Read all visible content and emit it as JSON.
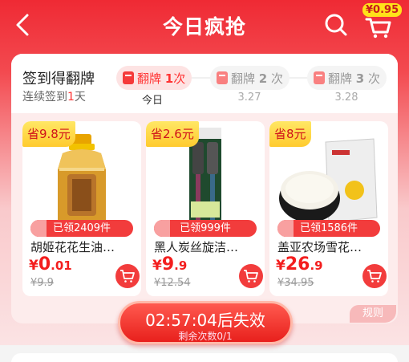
{
  "header": {
    "title": "今日疯抢",
    "cart_badge": "¥0.95"
  },
  "signin": {
    "title": "签到得翻牌",
    "sub_prefix": "连续签到",
    "sub_days": "1",
    "sub_suffix": "天",
    "steps": [
      {
        "label": "翻牌",
        "count": "1",
        "unit": "次",
        "date": "今日"
      },
      {
        "label": "翻牌",
        "count": "2",
        "unit": "次",
        "date": "3.27"
      },
      {
        "label": "翻牌",
        "count": "3",
        "unit": "次",
        "date": "3.28"
      }
    ]
  },
  "products": [
    {
      "save": "省9.8元",
      "claimed": "已领2409件",
      "name": "胡姬花花生油…",
      "yen": "¥",
      "price_int": "0",
      "price_dec": ".01",
      "orig": "¥9.9"
    },
    {
      "save": "省2.6元",
      "claimed": "已领999件",
      "name": "黑人炭丝旋洁…",
      "yen": "¥",
      "price_int": "9",
      "price_dec": ".9",
      "orig": "¥12.54"
    },
    {
      "save": "省8元",
      "claimed": "已领1586件",
      "name": "盖亚农场雪花…",
      "yen": "¥",
      "price_int": "26",
      "price_dec": ".9",
      "orig": "¥34.95"
    }
  ],
  "timer": {
    "countdown": "02:57:04后失效",
    "remaining": "剩余次数0/1"
  },
  "rules_label": "规则",
  "colors": {
    "brand_red": "#ef2a34",
    "price_red": "#f31e1e",
    "save_yellow": "#ffd83a"
  }
}
